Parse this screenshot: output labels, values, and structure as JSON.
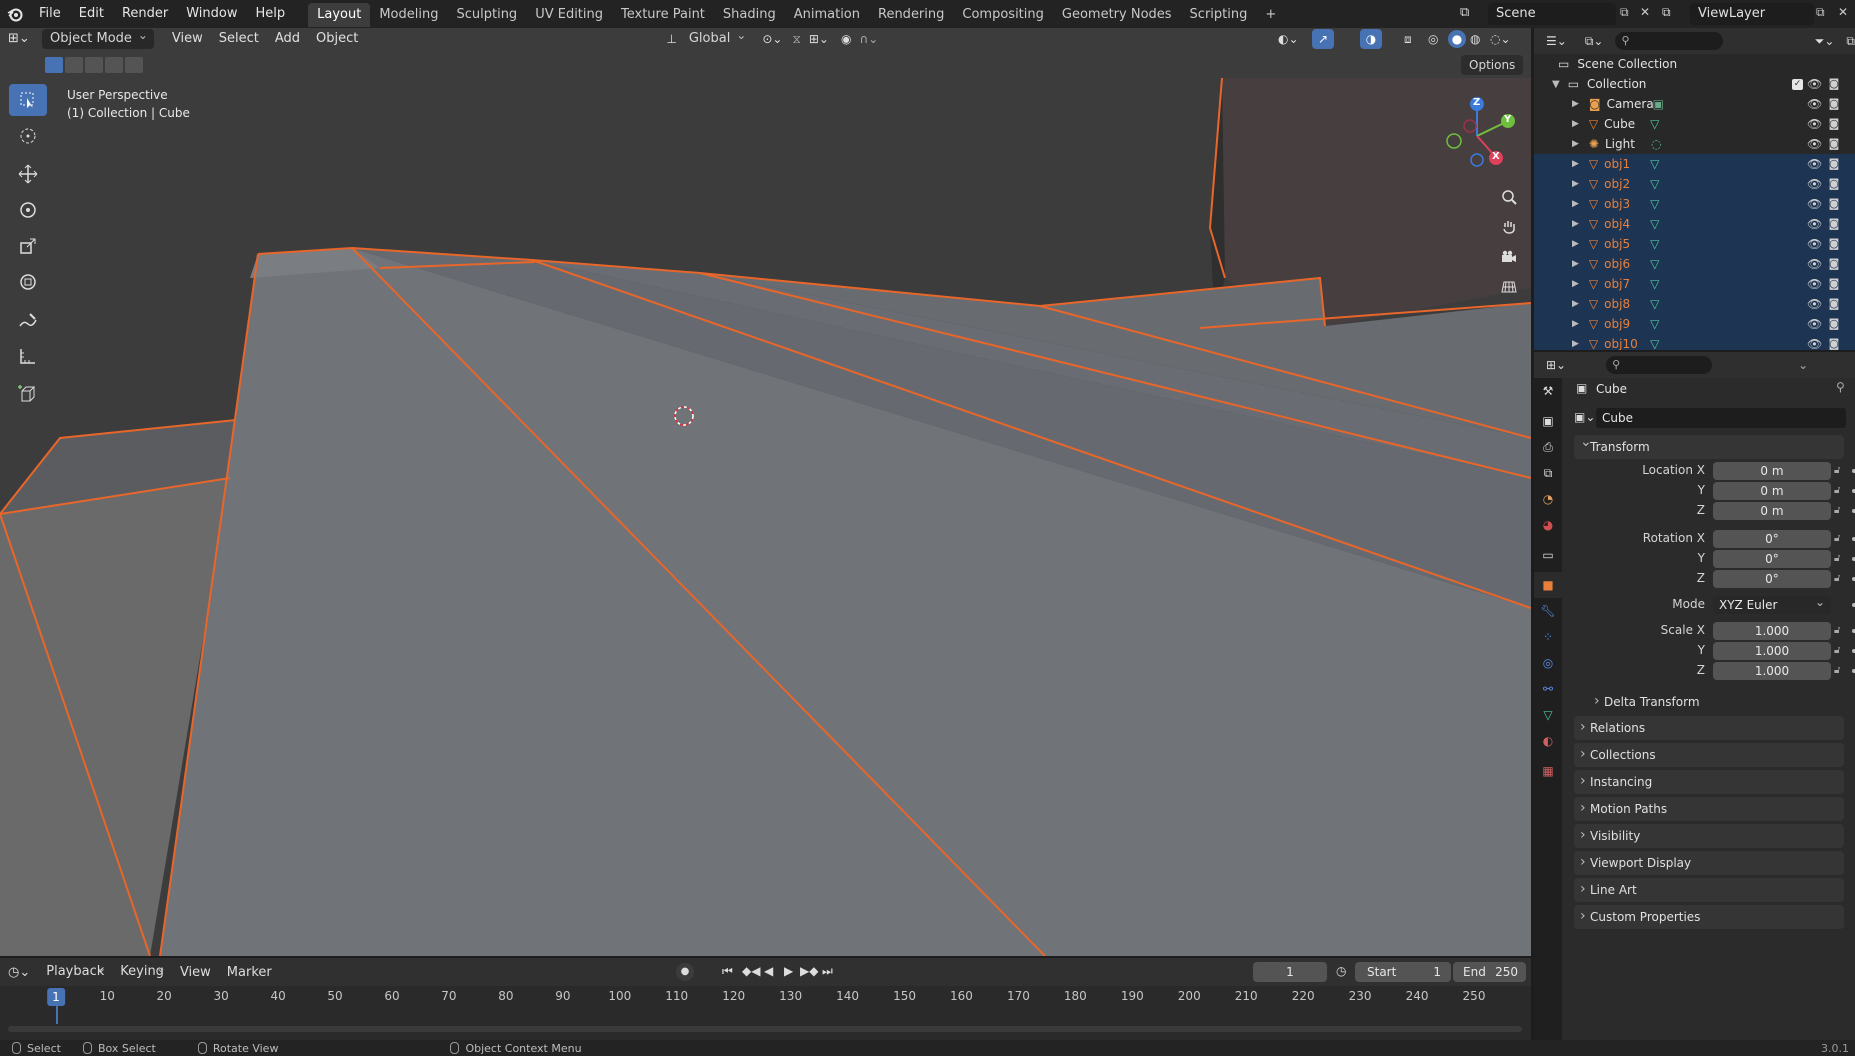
{
  "topbar": {
    "menus": [
      "File",
      "Edit",
      "Render",
      "Window",
      "Help"
    ],
    "workspaces": [
      "Layout",
      "Modeling",
      "Sculpting",
      "UV Editing",
      "Texture Paint",
      "Shading",
      "Animation",
      "Rendering",
      "Compositing",
      "Geometry Nodes",
      "Scripting"
    ],
    "active_workspace": "Layout",
    "add_tab": "+",
    "scene": "Scene",
    "view_layer": "ViewLayer"
  },
  "viewport": {
    "mode": "Object Mode",
    "menus": [
      "View",
      "Select",
      "Add",
      "Object"
    ],
    "orientation": "Global",
    "options": "Options",
    "info_line1": "User Perspective",
    "info_line2": "(1) Collection | Cube",
    "gizmo_axes": {
      "x": "X",
      "y": "Y",
      "z": "Z"
    },
    "colors": {
      "background": "#3c3c3c",
      "selection_outline": "#e8662a",
      "face": "#6f7278",
      "active_tool": "#4772b3"
    }
  },
  "timeline": {
    "menus": [
      "Playback",
      "Keying",
      "View",
      "Marker"
    ],
    "current_frame": "1",
    "start_label": "Start",
    "start": "1",
    "end_label": "End",
    "end": "250",
    "ticks": [
      "1",
      "10",
      "20",
      "30",
      "40",
      "50",
      "60",
      "70",
      "80",
      "90",
      "100",
      "110",
      "120",
      "130",
      "140",
      "150",
      "160",
      "170",
      "180",
      "190",
      "200",
      "210",
      "220",
      "230",
      "240",
      "250"
    ]
  },
  "statusbar": {
    "items": [
      "Select",
      "Box Select",
      "Rotate View",
      "Object Context Menu"
    ],
    "version": "3.0.1"
  },
  "outliner": {
    "root": "Scene Collection",
    "collection": "Collection",
    "items": [
      {
        "name": "Camera",
        "icon": "camera-icon",
        "selected": false
      },
      {
        "name": "Cube",
        "icon": "mesh-icon",
        "selected": false
      },
      {
        "name": "Light",
        "icon": "light-icon",
        "selected": false
      },
      {
        "name": "obj1",
        "icon": "mesh-icon",
        "selected": true
      },
      {
        "name": "obj2",
        "icon": "mesh-icon",
        "selected": true
      },
      {
        "name": "obj3",
        "icon": "mesh-icon",
        "selected": true
      },
      {
        "name": "obj4",
        "icon": "mesh-icon",
        "selected": true
      },
      {
        "name": "obj5",
        "icon": "mesh-icon",
        "selected": true
      },
      {
        "name": "obj6",
        "icon": "mesh-icon",
        "selected": true
      },
      {
        "name": "obj7",
        "icon": "mesh-icon",
        "selected": true
      },
      {
        "name": "obj8",
        "icon": "mesh-icon",
        "selected": true
      },
      {
        "name": "obj9",
        "icon": "mesh-icon",
        "selected": true
      },
      {
        "name": "obj10",
        "icon": "mesh-icon",
        "selected": true
      }
    ]
  },
  "properties": {
    "object_title": "Cube",
    "object_name": "Cube",
    "transform": {
      "title": "Transform",
      "location_label": "Location X",
      "rotation_label": "Rotation X",
      "mode_label": "Mode",
      "scale_label": "Scale X",
      "y_label": "Y",
      "z_label": "Z",
      "location": [
        "0 m",
        "0 m",
        "0 m"
      ],
      "rotation": [
        "0°",
        "0°",
        "0°"
      ],
      "mode": "XYZ Euler",
      "scale": [
        "1.000",
        "1.000",
        "1.000"
      ]
    },
    "delta_transform": "Delta Transform",
    "panels": [
      "Relations",
      "Collections",
      "Instancing",
      "Motion Paths",
      "Visibility",
      "Viewport Display",
      "Line Art",
      "Custom Properties"
    ]
  }
}
